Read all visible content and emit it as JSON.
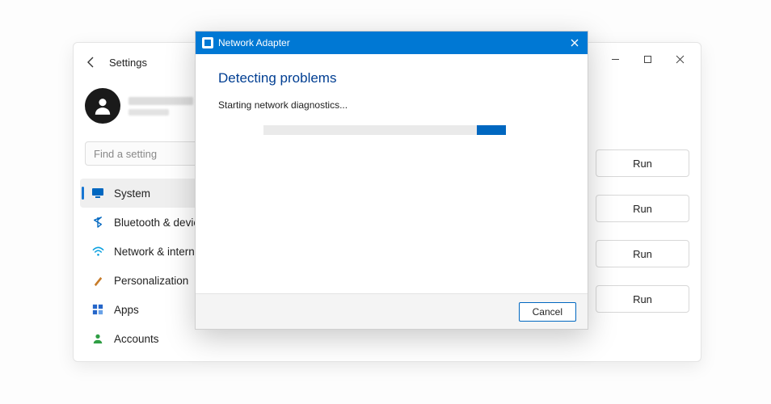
{
  "settings": {
    "title": "Settings",
    "search_placeholder": "Find a setting",
    "nav": [
      {
        "label": "System",
        "icon": "monitor-icon",
        "active": true
      },
      {
        "label": "Bluetooth & devices",
        "icon": "bluetooth-icon",
        "active": false
      },
      {
        "label": "Network & internet",
        "icon": "wifi-icon",
        "active": false
      },
      {
        "label": "Personalization",
        "icon": "brush-icon",
        "active": false
      },
      {
        "label": "Apps",
        "icon": "apps-icon",
        "active": false
      },
      {
        "label": "Accounts",
        "icon": "person-icon",
        "active": false
      }
    ],
    "run_label": "Run"
  },
  "troubleshooter": {
    "window_title": "Network Adapter",
    "heading": "Detecting problems",
    "status": "Starting network diagnostics...",
    "cancel_label": "Cancel"
  }
}
